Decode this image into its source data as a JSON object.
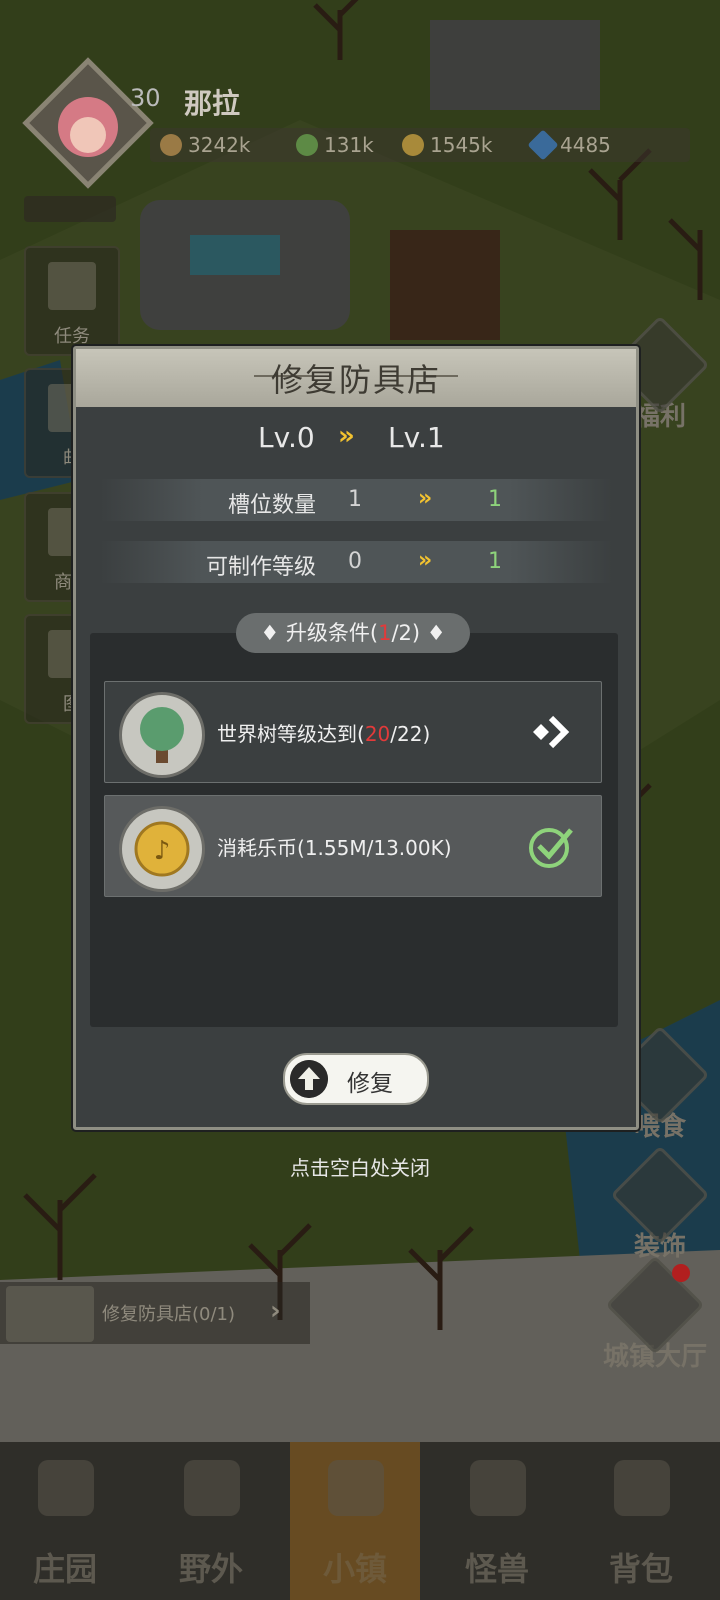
{
  "hud": {
    "level": "30",
    "name": "那拉",
    "resources": [
      {
        "icon": "medal-icon",
        "value": "3242k"
      },
      {
        "icon": "leaf-icon",
        "value": "131k"
      },
      {
        "icon": "coin-icon",
        "value": "1545k"
      },
      {
        "icon": "diamond-icon",
        "value": "4485"
      }
    ]
  },
  "left_menu": [
    {
      "label": "任务",
      "icon": "book-icon"
    },
    {
      "label": "邮",
      "icon": "mail-icon"
    },
    {
      "label": "商店",
      "icon": "shop-icon"
    },
    {
      "label": "图",
      "icon": "gallery-icon"
    }
  ],
  "right_menu": [
    {
      "label": "福利",
      "icon": "gift-icon"
    },
    {
      "label": "喂食",
      "icon": "food-icon"
    },
    {
      "label": "装饰",
      "icon": "decorate-icon"
    },
    {
      "label": "城镇大厅",
      "icon": "hall-icon"
    }
  ],
  "modal": {
    "title": "修复防具店",
    "level_from": "Lv.0",
    "level_to": "Lv.1",
    "arrow": "»",
    "stats": [
      {
        "name": "槽位数量",
        "from": "1",
        "to": "1"
      },
      {
        "name": "可制作等级",
        "from": "0",
        "to": "1"
      }
    ],
    "conditions_label": "升级条件",
    "conditions_done": "1",
    "conditions_total": "2",
    "conditions": [
      {
        "icon": "tree-icon",
        "text": "世界树等级达到",
        "current": "20",
        "required": "22",
        "met": false
      },
      {
        "icon": "music-coin-icon",
        "text": "消耗乐币",
        "current": "1.55M",
        "required": "13.00K",
        "met": true
      }
    ],
    "repair_label": "修复",
    "close_hint": "点击空白处关闭"
  },
  "quest": {
    "label": "修复防具店(0/1)"
  },
  "bottom_nav": [
    {
      "label": "庄园",
      "active": false
    },
    {
      "label": "野外",
      "active": false
    },
    {
      "label": "小镇",
      "active": true
    },
    {
      "label": "怪兽",
      "active": false
    },
    {
      "label": "背包",
      "active": false
    }
  ],
  "colors": {
    "accent_gold": "#f2c230",
    "met_green": "#8ed37b",
    "unmet_red": "#e23a3a"
  }
}
